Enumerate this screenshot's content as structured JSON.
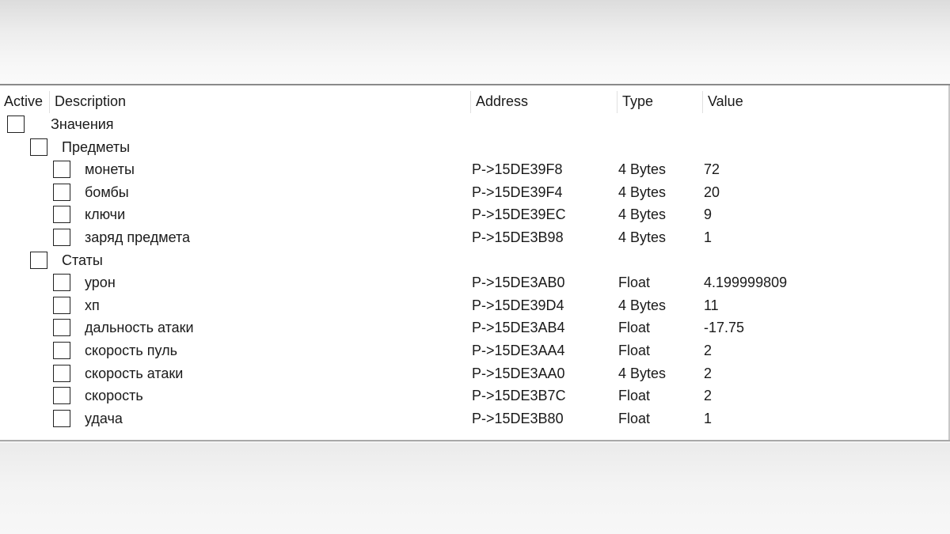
{
  "columns": {
    "active": "Active",
    "description": "Description",
    "address": "Address",
    "type": "Type",
    "value": "Value"
  },
  "rows": [
    {
      "level": 0,
      "description": "Значения",
      "address": "",
      "type": "",
      "value": ""
    },
    {
      "level": 1,
      "description": "Предметы",
      "address": "",
      "type": "",
      "value": ""
    },
    {
      "level": 2,
      "description": "монеты",
      "address": "P->15DE39F8",
      "type": "4 Bytes",
      "value": "72"
    },
    {
      "level": 2,
      "description": "бомбы",
      "address": "P->15DE39F4",
      "type": "4 Bytes",
      "value": "20"
    },
    {
      "level": 2,
      "description": "ключи",
      "address": "P->15DE39EC",
      "type": "4 Bytes",
      "value": "9"
    },
    {
      "level": 2,
      "description": "заряд предмета",
      "address": "P->15DE3B98",
      "type": "4 Bytes",
      "value": "1"
    },
    {
      "level": 1,
      "description": "Статы",
      "address": "",
      "type": "",
      "value": ""
    },
    {
      "level": 2,
      "description": "урон",
      "address": "P->15DE3AB0",
      "type": "Float",
      "value": "4.199999809"
    },
    {
      "level": 2,
      "description": "хп",
      "address": "P->15DE39D4",
      "type": "4 Bytes",
      "value": "11"
    },
    {
      "level": 2,
      "description": "дальность атаки",
      "address": "P->15DE3AB4",
      "type": "Float",
      "value": "-17.75"
    },
    {
      "level": 2,
      "description": "скорость пуль",
      "address": "P->15DE3AA4",
      "type": "Float",
      "value": "2"
    },
    {
      "level": 2,
      "description": "скорость атаки",
      "address": "P->15DE3AA0",
      "type": "4 Bytes",
      "value": "2"
    },
    {
      "level": 2,
      "description": "скорость",
      "address": "P->15DE3B7C",
      "type": "Float",
      "value": "2"
    },
    {
      "level": 2,
      "description": "удача",
      "address": "P->15DE3B80",
      "type": "Float",
      "value": "1"
    }
  ]
}
